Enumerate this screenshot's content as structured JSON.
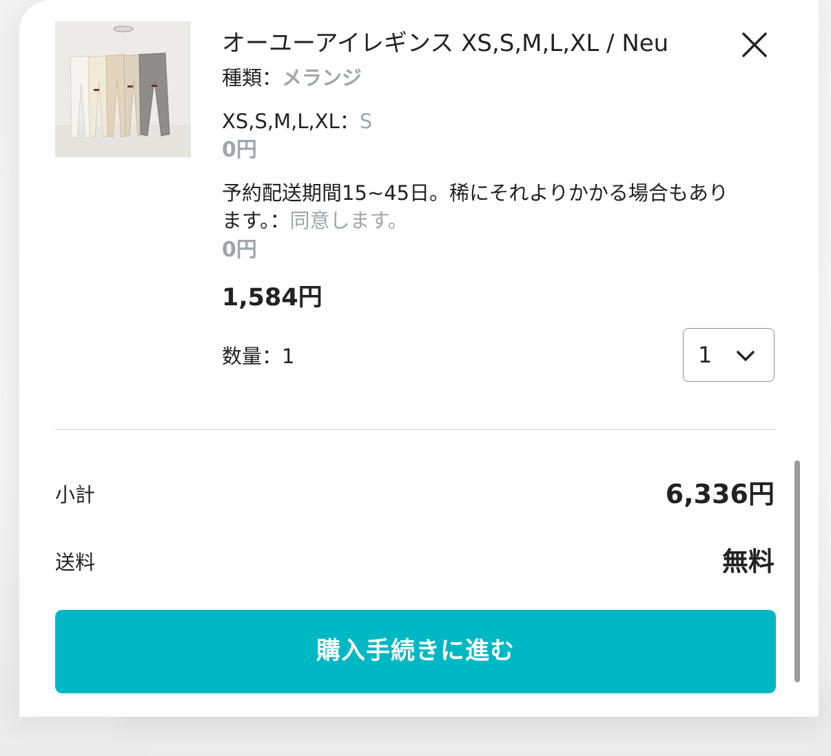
{
  "product": {
    "title": "オーユーアイレギンス XS,S,M,L,XL / Neu",
    "image_alt": "leggings product photo",
    "option1_label": "種類：",
    "option1_value": "メランジ",
    "option2_label": "XS,S,M,L,XL：",
    "option2_value": "S",
    "option2_price": "0円",
    "note_line1": "予約配送期間15~45日。稀にそれよりかかる場合もあり",
    "note_line2_prefix": "ます。：",
    "note_line2_value": "同意します。",
    "note_price": "0円",
    "unit_price": "1,584円",
    "quantity_label": "数量：1",
    "quantity_selected": "1"
  },
  "summary": {
    "subtotal_label": "小計",
    "subtotal_value": "6,336円",
    "shipping_label": "送料",
    "shipping_value": "無料"
  },
  "actions": {
    "checkout_label": "購入手続きに進む",
    "close_icon": "close-icon",
    "dropdown_icon": "chevron-down-icon"
  },
  "colors": {
    "accent": "#00b8c4",
    "muted_text": "#9ea6ad",
    "primary_text": "#222222"
  }
}
